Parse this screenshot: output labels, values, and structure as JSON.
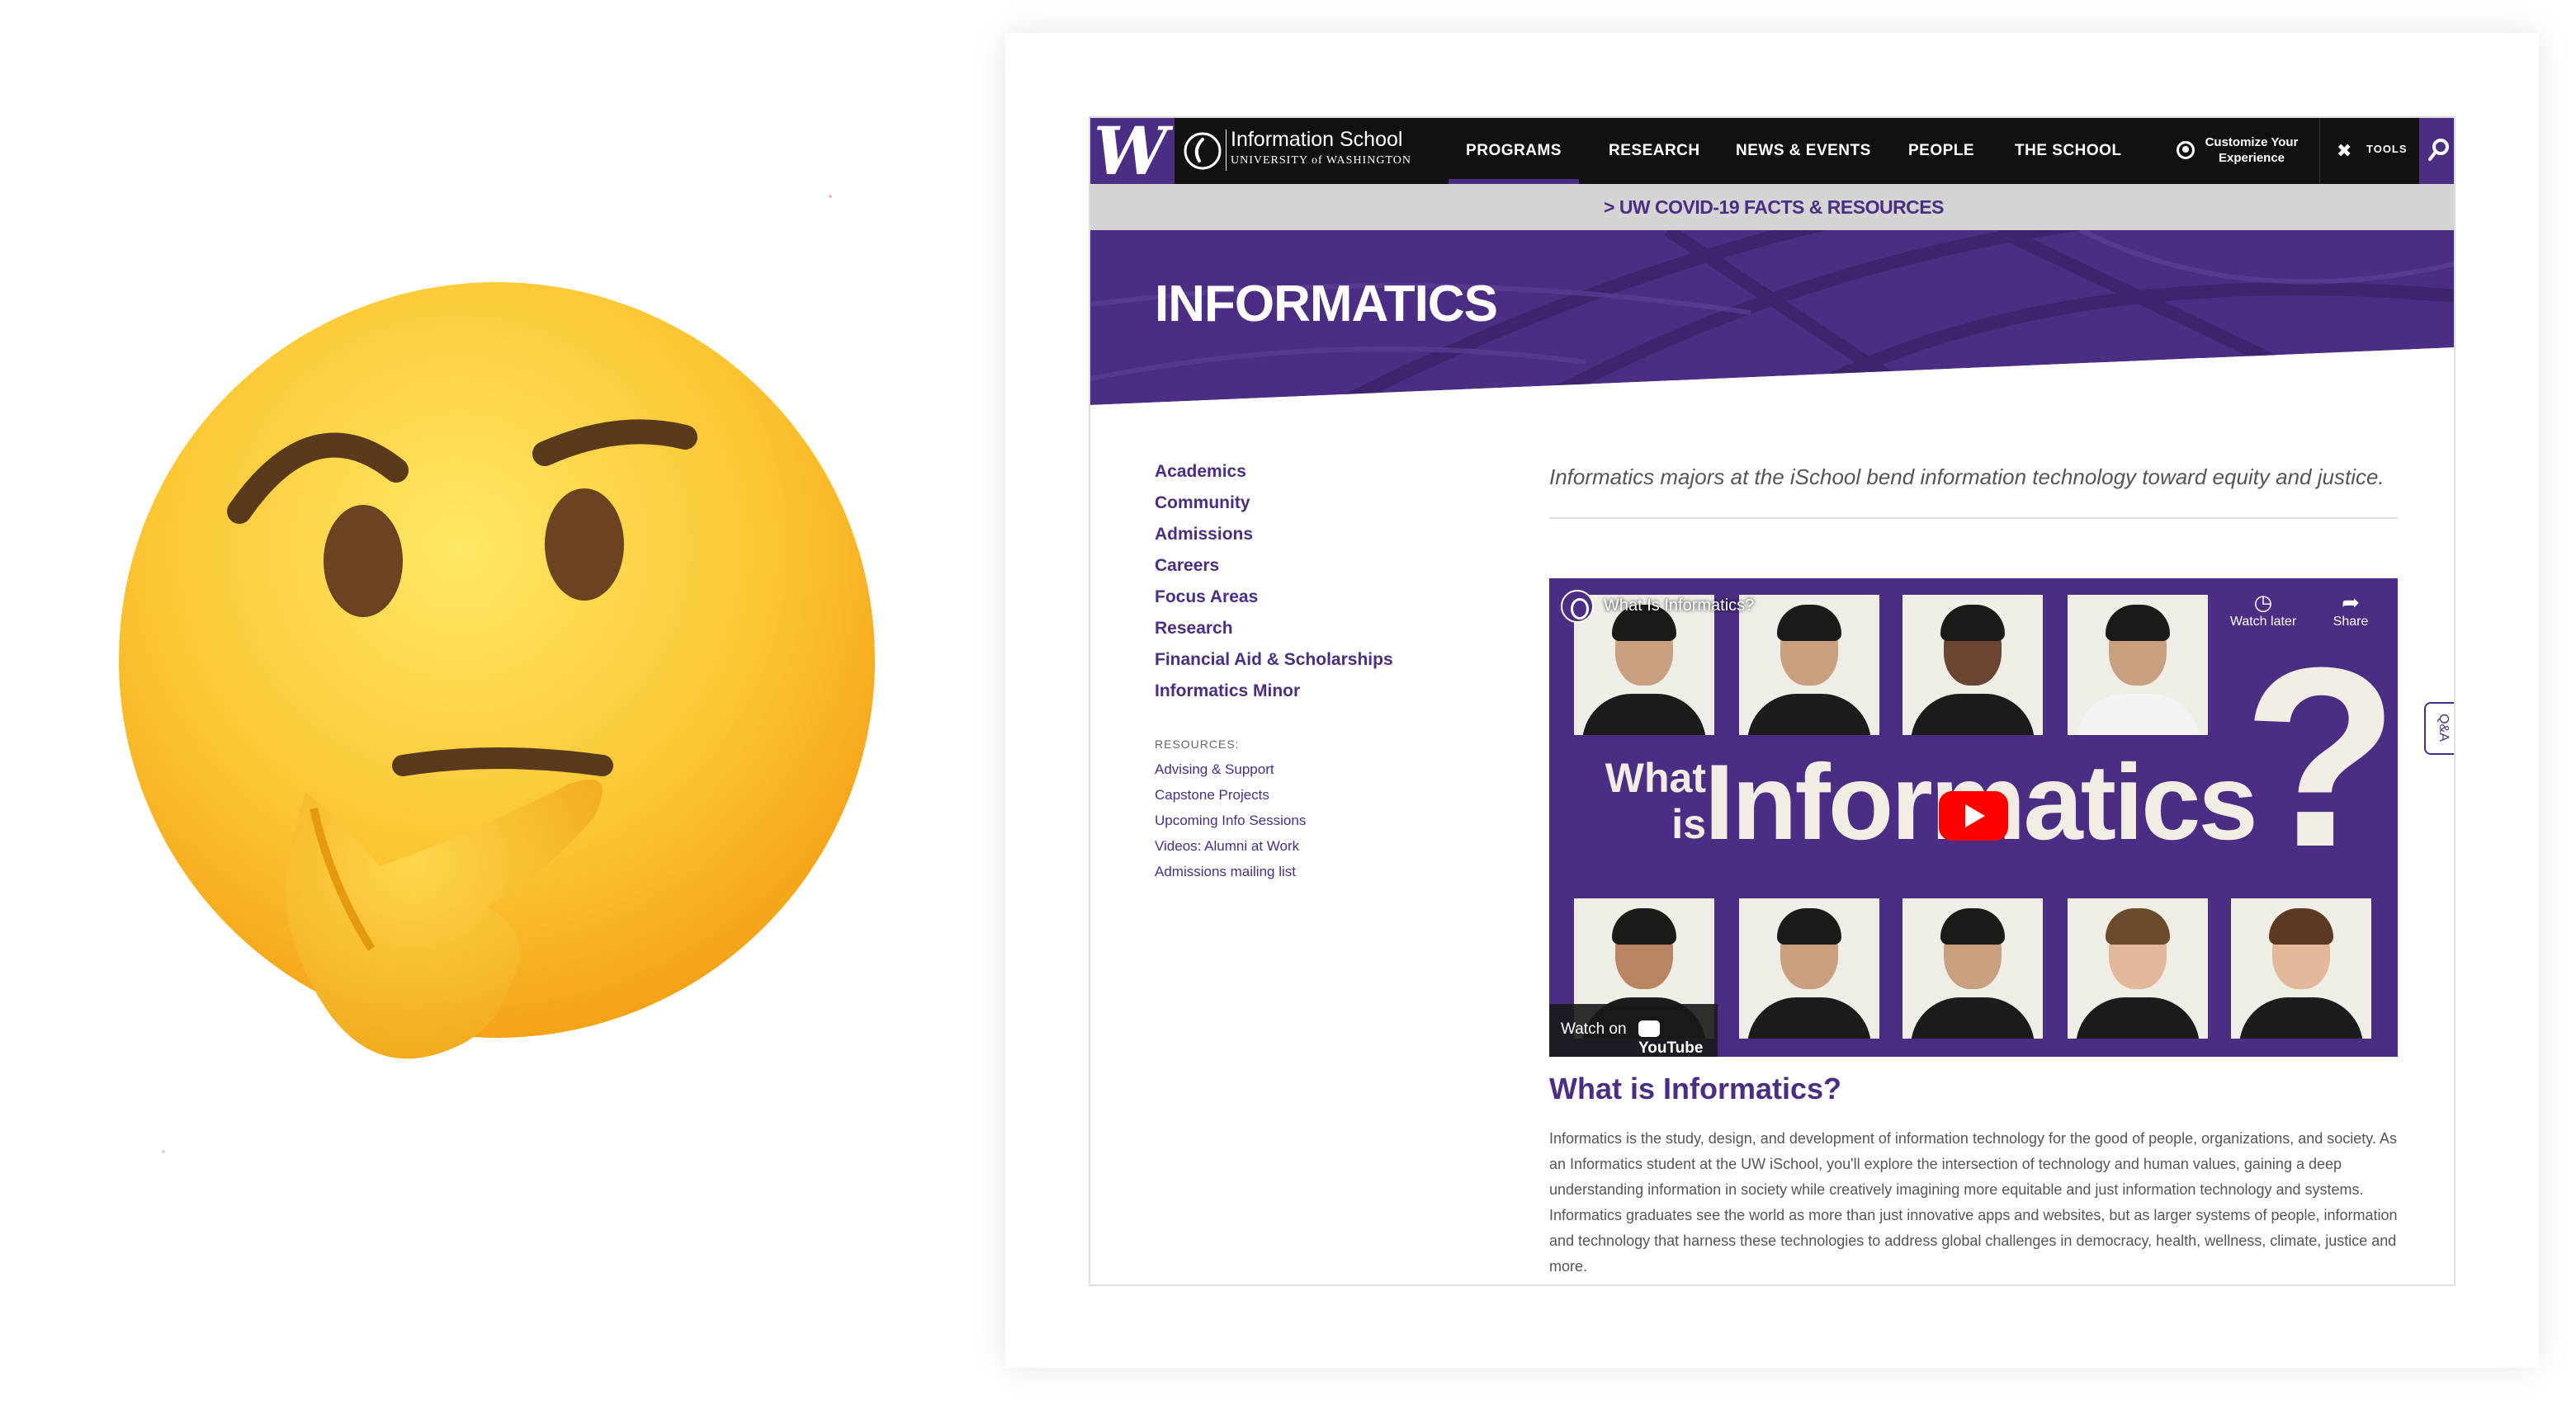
{
  "topnav": {
    "uw_logo": "W",
    "ischool_name": "Information School",
    "ischool_sub": "UNIVERSITY of WASHINGTON",
    "items": [
      "PROGRAMS",
      "RESEARCH",
      "NEWS & EVENTS",
      "PEOPLE",
      "THE SCHOOL"
    ],
    "customize_label": "Customize Your Experience",
    "tools_label": "TOOLS"
  },
  "covid_bar": {
    "link": ">  UW COVID-19 FACTS & RESOURCES"
  },
  "hero": {
    "title": "INFORMATICS"
  },
  "sidebar": {
    "links": [
      "Academics",
      "Community",
      "Admissions",
      "Careers",
      "Focus Areas",
      "Research",
      "Financial Aid & Scholarships",
      "Informatics Minor"
    ],
    "resources_label": "RESOURCES:",
    "resources": [
      "Advising & Support",
      "Capstone Projects",
      "Upcoming Info Sessions",
      "Videos: Alumni at Work",
      "Admissions mailing list"
    ]
  },
  "main": {
    "intro": "Informatics majors at the iSchool bend information technology toward equity and justice.",
    "video": {
      "title": "What Is Informatics?",
      "watch_later": "Watch later",
      "share": "Share",
      "graphic_what": "What",
      "graphic_is": "is",
      "graphic_word": "Informatics",
      "graphic_mark": "?",
      "watch_on": "Watch on",
      "youtube": "YouTube"
    },
    "heading": "What is Informatics?",
    "body": "Informatics is the study, design, and development of information technology for the good of people, organizations, and society. As an Informatics student at the UW iSchool, you'll explore the intersection of technology and human values, gaining a deep understanding information in society while creatively imagining more equitable and just information technology and systems. Informatics graduates see the world as more than just innovative apps and websites, but as larger systems of people, information and technology that harness these technologies to address global challenges in democracy, health, wellness, climate, justice and more."
  },
  "qa_tab": "Q&A",
  "colors": {
    "uw_purple": "#4b2e83",
    "nav_black": "#111111",
    "covid_gray": "#d4d4d4"
  },
  "icons": [
    "thinking-face-emoji",
    "user-circle-icon",
    "tools-icon",
    "search-icon",
    "clock-icon",
    "share-icon",
    "play-icon"
  ]
}
